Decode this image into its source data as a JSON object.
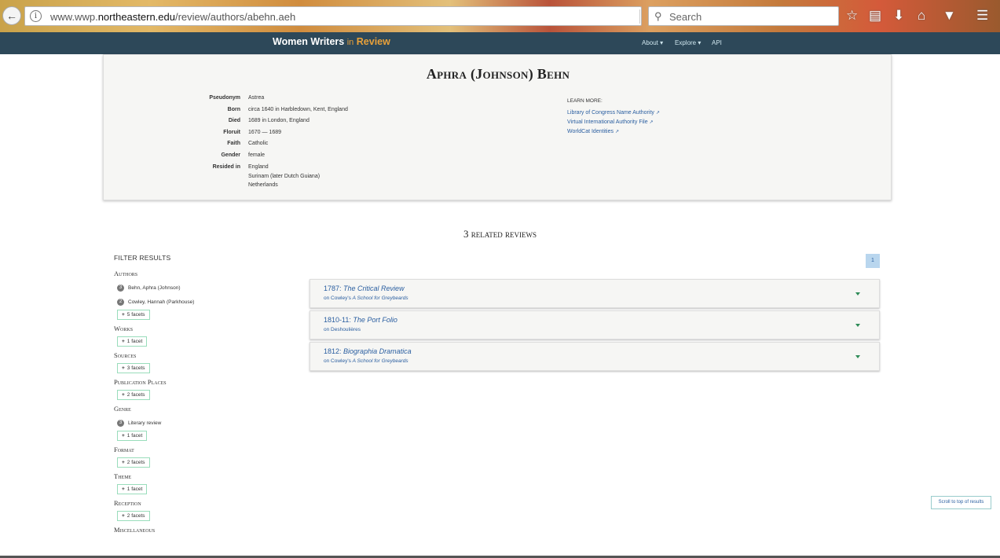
{
  "browser": {
    "url_prefix": "www.wwp.",
    "url_domain": "northeastern.edu",
    "url_path": "/review/authors/abehn.aeh",
    "search_placeholder": "Search"
  },
  "site": {
    "brand_main": "Women Writers",
    "brand_in": "in",
    "brand_review": "Review",
    "nav": [
      "About",
      "Explore",
      "API"
    ]
  },
  "author": {
    "name": "Aphra (Johnson) Behn",
    "facts": [
      {
        "label": "Pseudonym",
        "value": "Astrea"
      },
      {
        "label": "Born",
        "value": "circa 1640 in Harbledown, Kent, England"
      },
      {
        "label": "Died",
        "value": "1689 in London, England"
      },
      {
        "label": "Floruit",
        "value": "1670 — 1689"
      },
      {
        "label": "Faith",
        "value": "Catholic"
      },
      {
        "label": "Gender",
        "value": "female"
      }
    ],
    "resided_label": "Resided in",
    "resided": [
      "England",
      "Surinam (later Dutch Guiana)",
      "Netherlands"
    ],
    "learn_more_title": "Learn more:",
    "learn_more_links": [
      "Library of Congress Name Authority",
      "Virtual International Authority File",
      "WorldCat Identities"
    ]
  },
  "related": {
    "title": "3 related reviews",
    "page": "1",
    "reviews": [
      {
        "year": "1787:",
        "source": "The Critical Review",
        "on": "on Cowley's",
        "work": "A School for Greybeards"
      },
      {
        "year": "1810-11:",
        "source": "The Port Folio",
        "on": "on Deshoulières",
        "work": ""
      },
      {
        "year": "1812:",
        "source": "Biographia Dramatica",
        "on": "on Cowley's",
        "work": "A School for Greybeards"
      }
    ]
  },
  "filters": {
    "heading": "Filter Results",
    "authors_title": "Authors",
    "authors": [
      {
        "count": "3",
        "name": "Behn, Aphra (Johnson)"
      },
      {
        "count": "2",
        "name": "Cowley, Hannah (Parkhouse)"
      }
    ],
    "authors_more": "5 facets",
    "works_title": "Works",
    "works_more": "1 facet",
    "sources_title": "Sources",
    "sources_more": "3 facets",
    "pubplaces_title": "Publication Places",
    "pubplaces_more": "2 facets",
    "genre_title": "Genre",
    "genre_item": {
      "count": "3",
      "name": "Literary review"
    },
    "genre_more": "1 facet",
    "format_title": "Format",
    "format_more": "2 facets",
    "theme_title": "Theme",
    "theme_more": "1 facet",
    "reception_title": "Reception",
    "reception_more": "2 facets",
    "misc_title": "Miscellaneous"
  },
  "scroll_top_label": "Scroll to top of results"
}
